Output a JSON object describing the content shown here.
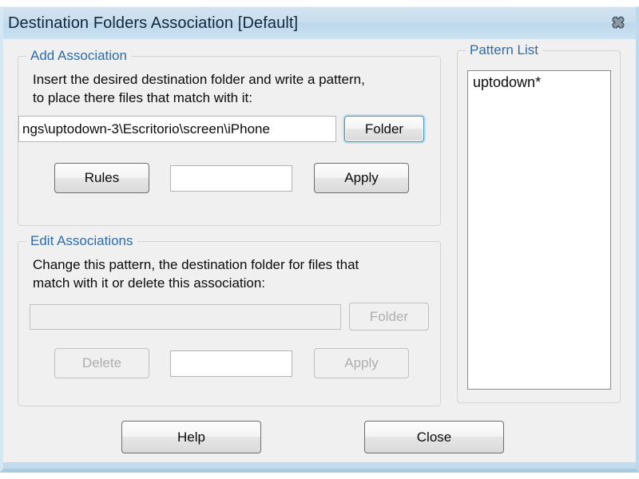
{
  "window": {
    "title": "Destination Folders Association [Default]",
    "close_icon": "close-icon",
    "close_glyph": "✖",
    "titlebar_color": "#c9deee",
    "frame_color": "#bfd9ec",
    "client_background": "#f0f0f0",
    "legend_color": "#2f6ca8"
  },
  "add_association": {
    "legend": "Add Association",
    "instruction_line1": "Insert the desired destination folder and write a pattern,",
    "instruction_line2": "to place there files that match with it:",
    "folder_input_value": "ngs\\uptodown-3\\Escritorio\\screen\\iPhone",
    "folder_input_placeholder": "",
    "folder_button_label": "Folder",
    "rules_button_label": "Rules",
    "pattern_input_value": "",
    "pattern_input_placeholder": "",
    "apply_button_label": "Apply"
  },
  "edit_associations": {
    "legend": "Edit Associations",
    "instruction_line1": "Change this pattern, the destination folder for files that",
    "instruction_line2": "match with it or delete this association:",
    "folder_input_value": "",
    "folder_input_placeholder": "",
    "folder_button_label": "Folder",
    "delete_button_label": "Delete",
    "pattern_input_value": "",
    "pattern_input_placeholder": "",
    "apply_button_label": "Apply"
  },
  "pattern_list": {
    "legend": "Pattern List",
    "items": [
      {
        "label": "uptodown*"
      }
    ]
  },
  "footer": {
    "help_button_label": "Help",
    "close_button_label": "Close"
  }
}
